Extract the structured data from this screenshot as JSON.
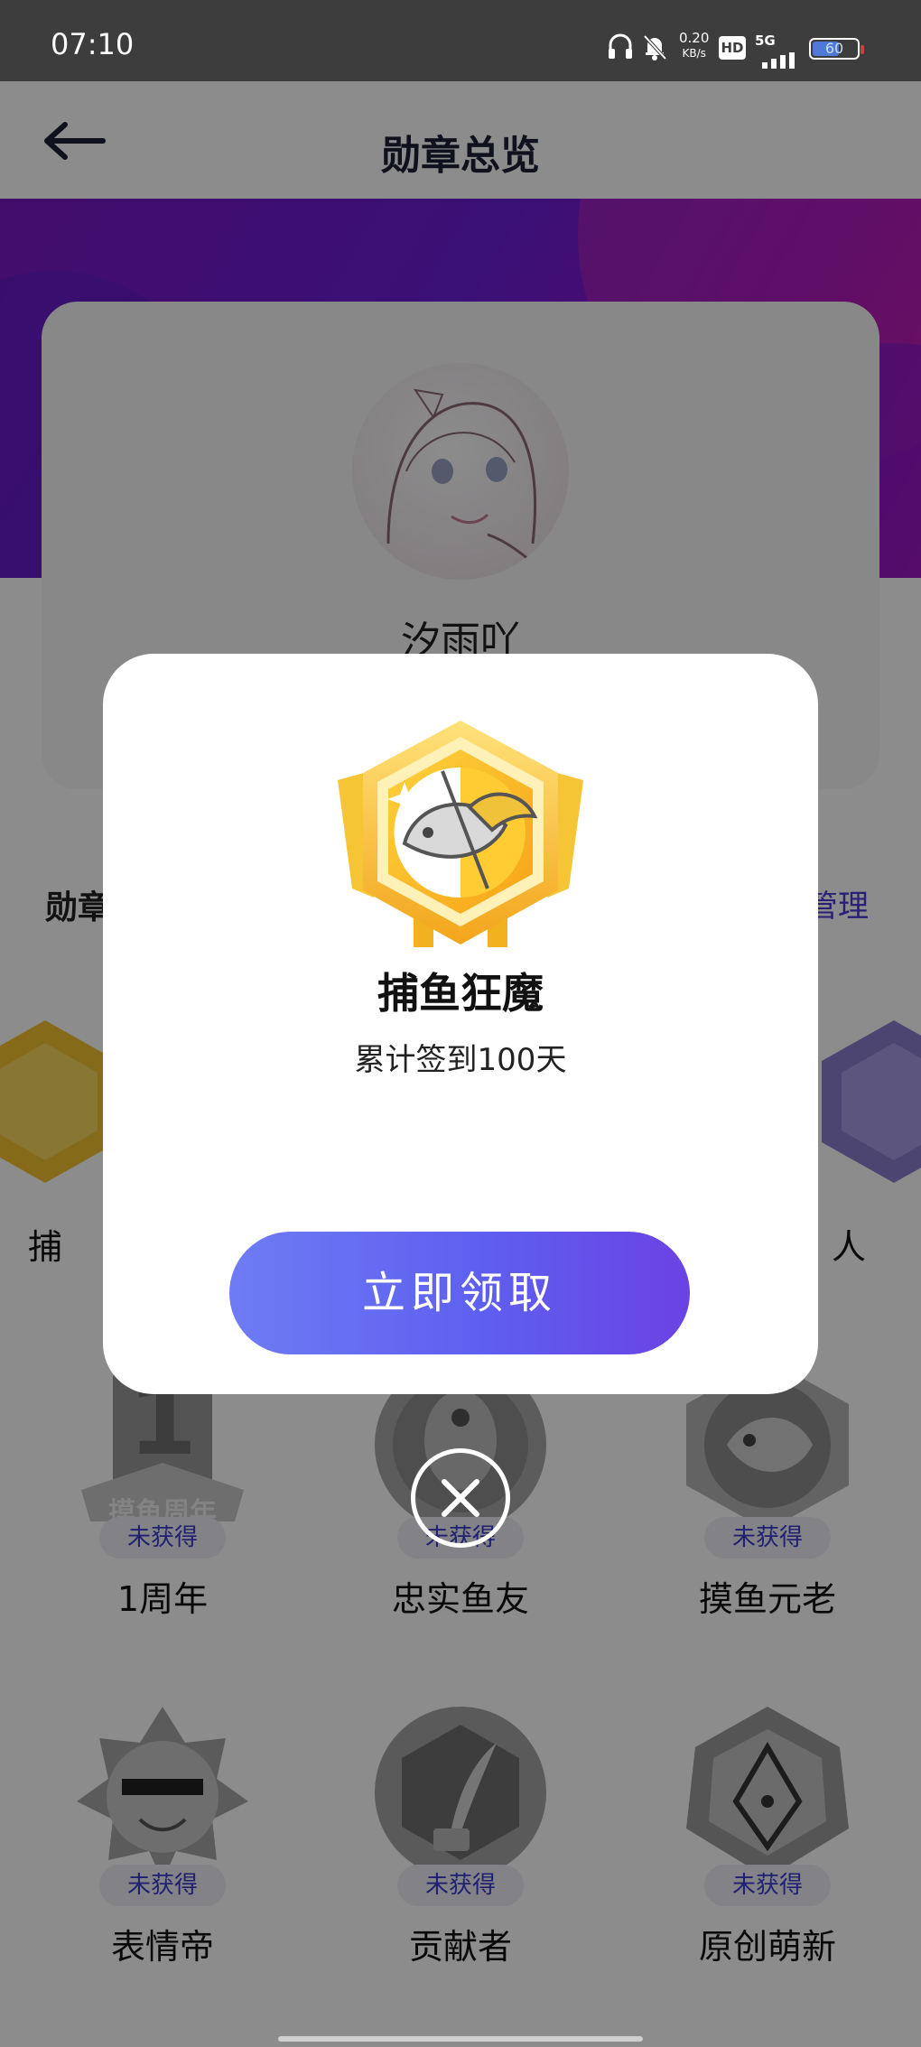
{
  "status_bar": {
    "time": "07:10",
    "net_speed_value": "0.20",
    "net_speed_unit": "KB/s",
    "hd": "HD",
    "network": "5G",
    "battery": "60"
  },
  "header": {
    "title": "勋章总览"
  },
  "profile": {
    "username": "汐雨吖"
  },
  "section": {
    "title": "勋章",
    "manage": "管理"
  },
  "badges": [
    {
      "name": "捕",
      "tag": ""
    },
    {
      "name": "人",
      "tag": ""
    },
    {
      "name": "1周年",
      "tag": "未获得",
      "medal_text": "摸鱼周年"
    },
    {
      "name": "忠实鱼友",
      "tag": "未获得"
    },
    {
      "name": "摸鱼元老",
      "tag": "未获得"
    },
    {
      "name": "表情帝",
      "tag": "未获得"
    },
    {
      "name": "贡献者",
      "tag": "未获得"
    },
    {
      "name": "原创萌新",
      "tag": "未获得"
    }
  ],
  "dialog": {
    "badge_name": "捕鱼狂魔",
    "description": "累计签到100天",
    "claim_label": "立即领取"
  },
  "colors": {
    "accent_purple": "#5e5ff0",
    "banner_purple": "#7a18c4",
    "tag_text": "#3b3bd0"
  }
}
